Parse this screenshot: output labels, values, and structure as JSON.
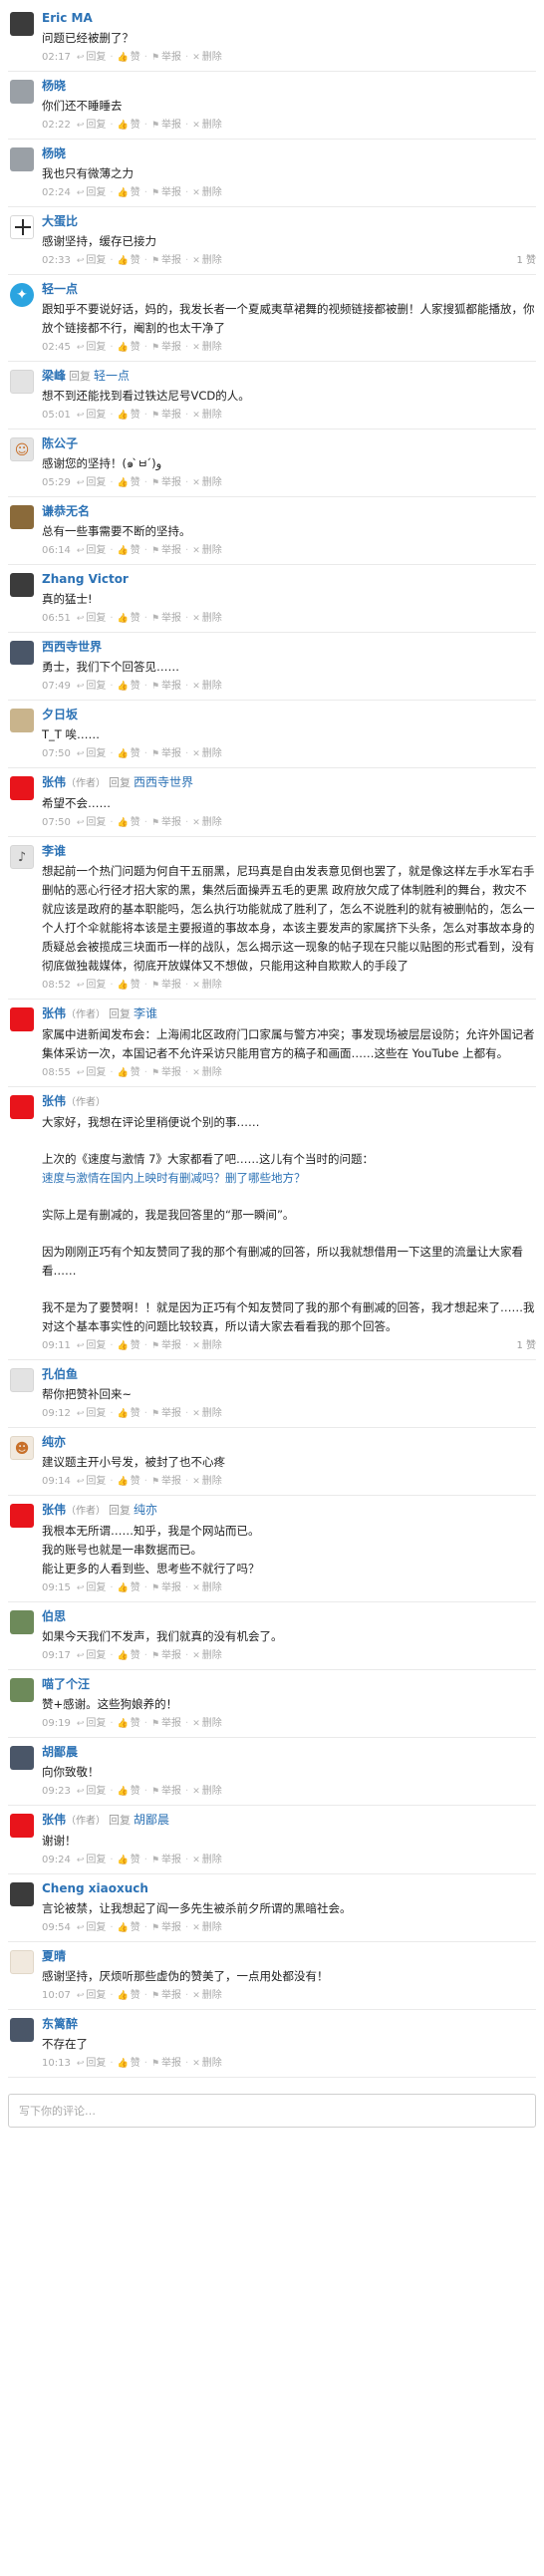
{
  "actions": {
    "reply": "回复",
    "like": "赞",
    "report": "举报",
    "delete": "删除",
    "reply_word": "回复",
    "author_role": "（作者）"
  },
  "icons": {
    "reply": "reply-icon",
    "like": "thumbs-up-icon",
    "report": "flag-icon",
    "delete": "trash-icon"
  },
  "comments": [
    {
      "name": "Eric MA",
      "text": "问题已经被删了？",
      "time": "02:17"
    },
    {
      "name": "杨晓",
      "text": "你们还不睡睡去",
      "time": "02:22"
    },
    {
      "name": "杨晓",
      "text": "我也只有微薄之力",
      "time": "02:24"
    },
    {
      "name": "大蛋比",
      "text": "感谢坚持，缓存已接力",
      "time": "02:33",
      "votes": "1 赞"
    },
    {
      "name": "轻一点",
      "text": "跟知乎不要说好话，妈的，我发长者一个夏威夷草裙舞的视频链接都被删！人家搜狐都能播放，你放个链接都不行，阉割的也太干净了",
      "time": "02:45"
    },
    {
      "name": "梁峰",
      "reply_to": "轻一点",
      "text": "想不到还能找到看过铁达尼号VCD的人。",
      "time": "05:01"
    },
    {
      "name": "陈公子",
      "text": "感谢您的坚持！(๑ ̀ㅂ ́)و",
      "time": "05:29"
    },
    {
      "name": "谦恭无名",
      "text": "总有一些事需要不断的坚持。",
      "time": "06:14"
    },
    {
      "name": "Zhang Victor",
      "text": "真的猛士!",
      "time": "06:51"
    },
    {
      "name": "西西寺世界",
      "text": "勇士，我们下个回答见……",
      "time": "07:49"
    },
    {
      "name": "夕日坂",
      "text": "T_T 唉……",
      "time": "07:50"
    },
    {
      "name": "张伟",
      "is_author": true,
      "reply_to": "西西寺世界",
      "text": "希望不会……",
      "time": "07:50"
    },
    {
      "name": "李谁",
      "text": "想起前一个热门问题为何自干五丽黑，尼玛真是自由发表意见倒也罢了，就是像这样左手水军右手删帖的恶心行径才招大家的黑，集然后面操弄五毛的更黑 政府放欠成了体制胜利的舞台，救灾不就应该是政府的基本职能吗，怎么执行功能就成了胜利了，怎么不说胜利的就有被删帖的，怎么一个人打个伞就能将本该是主要报道的事故本身，本该主要发声的家属挤下头条，怎么对事故本身的质疑总会被揽成三块面币一样的战队，怎么揭示这一现象的帖子现在只能以贴图的形式看到，没有彻底做独裁媒体，彻底开放媒体又不想做，只能用这种自欺欺人的手段了",
      "time": "08:52"
    },
    {
      "name": "张伟",
      "is_author": true,
      "reply_to": "李谁",
      "text": "家属中进新闻发布会：上海闹北区政府门口家属与警方冲突；事发现场被层层设防；允许外国记者集体采访一次，本国记者不允许采访只能用官方的稿子和画面……这些在 YouTube 上都有。",
      "time": "08:55"
    },
    {
      "name": "张伟",
      "is_author": true,
      "paragraphs": [
        {
          "text": "大家好，我想在评论里稍便说个别的事……"
        },
        {
          "text": "上次的《速度与激情 7》大家都看了吧……这儿有个当时的问题：",
          "gap": true
        },
        {
          "text": "速度与激情在国内上映时有删减吗？删了哪些地方？",
          "link": true
        },
        {
          "text": "实际上是有删减的，我是我回答里的“那一瞬间”。",
          "gap": true
        },
        {
          "text": "因为刚刚正巧有个知友赞同了我的那个有删减的回答，所以我就想借用一下这里的流量让大家看看……",
          "gap": true
        },
        {
          "text": "我不是为了要赞啊！！就是因为正巧有个知友赞同了我的那个有删减的回答，我才想起来了……我对这个基本事实性的问题比较较真，所以请大家去看看我的那个回答。",
          "gap": true
        }
      ],
      "time": "09:11",
      "votes": "1 赞"
    },
    {
      "name": "孔伯鱼",
      "text": "帮你把赞补回来~",
      "time": "09:12"
    },
    {
      "name": "纯亦",
      "text": "建议题主开小号发，被封了也不心疼",
      "time": "09:14"
    },
    {
      "name": "张伟",
      "is_author": true,
      "reply_to": "纯亦",
      "paragraphs": [
        {
          "text": "我根本无所谓……知乎，我是个网站而已。"
        },
        {
          "text": "我的账号也就是一串数据而已。"
        },
        {
          "text": "能让更多的人看到些、思考些不就行了吗？"
        }
      ],
      "time": "09:15"
    },
    {
      "name": "伯思",
      "text": "如果今天我们不发声，我们就真的没有机会了。",
      "time": "09:17"
    },
    {
      "name": "喵了个汪",
      "text": "赞+感谢。这些狗娘养的！",
      "time": "09:19"
    },
    {
      "name": "胡鄙晨",
      "text": "向你致敬！",
      "time": "09:23"
    },
    {
      "name": "张伟",
      "is_author": true,
      "reply_to": "胡鄙晨",
      "text": "谢谢！",
      "time": "09:24"
    },
    {
      "name": "Cheng xiaoxuch",
      "text": "言论被禁，让我想起了阎一多先生被杀前夕所谓的黑暗社会。",
      "time": "09:54"
    },
    {
      "name": "夏晴",
      "text": "感谢坚持，厌烦听那些虚伪的赞美了，一点用处都没有！",
      "time": "10:07"
    },
    {
      "name": "东篱醉",
      "text": "不存在了",
      "time": "10:13"
    }
  ],
  "composer": {
    "placeholder": "写下你的评论…"
  }
}
